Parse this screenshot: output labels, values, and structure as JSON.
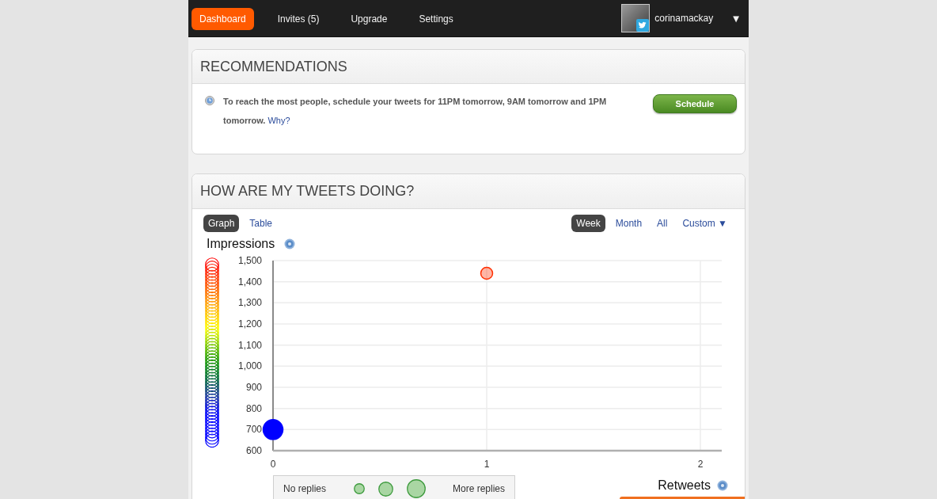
{
  "nav": {
    "items": [
      {
        "label": "Dashboard",
        "selected": true
      },
      {
        "label": "Invites (5)",
        "selected": false
      },
      {
        "label": "Upgrade",
        "selected": false
      },
      {
        "label": "Settings",
        "selected": false
      }
    ],
    "user": {
      "name": "corinamackay",
      "caret": "▼"
    }
  },
  "recommendations": {
    "title": "RECOMMENDATIONS",
    "items": [
      {
        "text": "To reach the most people, schedule your tweets for 11PM tomorrow, 9AM tomorrow and 1PM tomorrow.",
        "link": "Why?",
        "button": "Schedule"
      }
    ]
  },
  "tweets": {
    "title": "HOW ARE MY TWEETS DOING?",
    "view_tabs": [
      {
        "label": "Graph",
        "selected": true
      },
      {
        "label": "Table",
        "selected": false
      }
    ],
    "range_tabs": [
      {
        "label": "Week",
        "selected": true
      },
      {
        "label": "Month",
        "selected": false
      },
      {
        "label": "All",
        "selected": false
      },
      {
        "label": "Custom",
        "selected": false,
        "caret": "▼"
      }
    ],
    "chart_data": {
      "type": "scatter",
      "xlabel": "Retweets",
      "ylabel": "Impressions",
      "x": [
        0,
        1
      ],
      "series": [
        {
          "name": "No replies",
          "values": [
            null,
            1440
          ]
        },
        {
          "name": "More replies",
          "values": [
            700,
            null
          ]
        }
      ],
      "grid": true,
      "xlim": [
        0,
        2.1
      ],
      "ylim": [
        600,
        1500
      ],
      "xticks": [
        0,
        1,
        2
      ],
      "yticks": [
        600,
        700,
        800,
        900,
        {
          "value": 1000,
          "label": "1,000"
        },
        {
          "value": 1100,
          "label": "1,100"
        },
        {
          "value": 1200,
          "label": "1,200"
        },
        {
          "value": 1300,
          "label": "1,300"
        },
        {
          "value": 1400,
          "label": "1,400"
        },
        {
          "value": 1500,
          "label": "1,500"
        }
      ]
    }
  }
}
